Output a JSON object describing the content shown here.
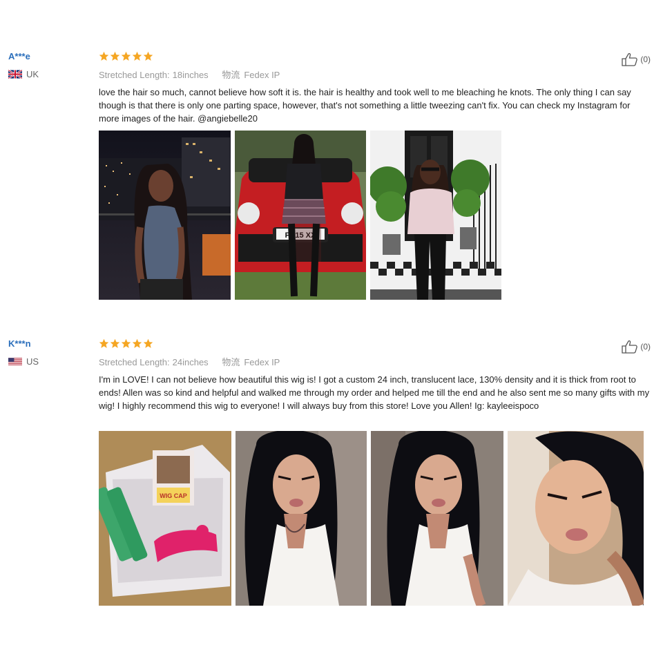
{
  "reviews": [
    {
      "name": "A***e",
      "country": "UK",
      "rating": 5,
      "length_label": "Stretched Length:",
      "length_value": "18inches",
      "logistics_label": "物流",
      "logistics_value": "Fedex IP",
      "helpful": "(0)",
      "text": "love the hair so much, cannot believe how soft it is. the hair is healthy and took well to me bleaching he knots. The only thing I can say though is that there is only one parting space, however, that's not something a little tweezing can't fix. You can check my Instagram for more images of the hair. @angiebelle20",
      "photo_texts": {
        "plate": "PX15  XX"
      }
    },
    {
      "name": "K***n",
      "country": "US",
      "rating": 5,
      "length_label": "Stretched Length:",
      "length_value": "24inches",
      "logistics_label": "物流",
      "logistics_value": "Fedex IP",
      "helpful": "(0)",
      "text": "I'm in LOVE! I can not believe how beautiful this wig is! I got a custom 24 inch, translucent lace, 130% density and it is thick from root to ends! Allen was so kind and helpful and walked me through my order and helped me till the end and he also sent me so many gifts with my wig! I highly recommend this wig to everyone! I will always buy from this store! Love you Allen! Ig: kayleeispoco",
      "photo_texts": {
        "wigcap": "WIG CAP"
      }
    }
  ],
  "colors": {
    "star": "#f5a623",
    "name": "#2a6ebb",
    "meta": "#999999"
  },
  "icons": {
    "thumb": "thumbs-up-icon",
    "star": "star-icon"
  }
}
